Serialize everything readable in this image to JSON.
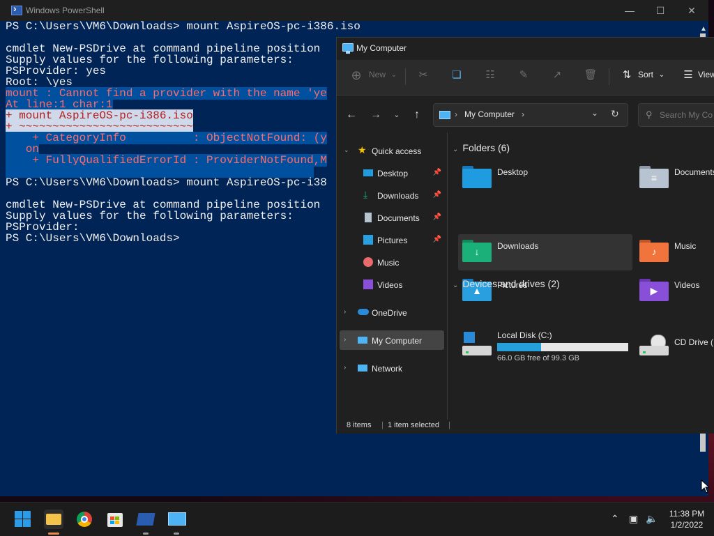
{
  "powershell": {
    "title": "Windows PowerShell",
    "lines": [
      {
        "text": "PS C:\\Users\\VM6\\Downloads> mount AspireOS-pc-i386.iso",
        "style": "normal"
      },
      {
        "text": "",
        "style": "normal"
      },
      {
        "text": "cmdlet New-PSDrive at command pipeline position",
        "style": "normal"
      },
      {
        "text": "Supply values for the following parameters:",
        "style": "normal"
      },
      {
        "text": "PSProvider: yes",
        "style": "normal"
      },
      {
        "text": "Root: \\yes",
        "style": "normal"
      },
      {
        "text": "mount : Cannot find a provider with the name 'ye",
        "style": "err-sel"
      },
      {
        "text": "At line:1 char:1",
        "style": "err-sel"
      },
      {
        "text": "+ mount AspireOS-pc-i386.iso",
        "style": "err-hl"
      },
      {
        "text": "+ ~~~~~~~~~~~~~~~~~~~~~~~~~~",
        "style": "err-hl"
      },
      {
        "text": "    + CategoryInfo          : ObjectNotFound: (y",
        "style": "err-sel"
      },
      {
        "text": "   on",
        "style": "err-sel"
      },
      {
        "text": "    + FullyQualifiedErrorId : ProviderNotFound,M",
        "style": "err-sel"
      },
      {
        "text": "",
        "style": "sel"
      },
      {
        "text": "PS C:\\Users\\VM6\\Downloads> mount AspireOS-pc-i38",
        "style": "normal"
      },
      {
        "text": "",
        "style": "normal"
      },
      {
        "text": "cmdlet New-PSDrive at command pipeline position",
        "style": "normal"
      },
      {
        "text": "Supply values for the following parameters:",
        "style": "normal"
      },
      {
        "text": "PSProvider:",
        "style": "normal"
      },
      {
        "text": "PS C:\\Users\\VM6\\Downloads>",
        "style": "normal"
      }
    ]
  },
  "explorer": {
    "title": "My Computer",
    "toolbar": {
      "new_label": "New",
      "sort_label": "Sort",
      "view_label": "View"
    },
    "address": {
      "crumb": "My Computer",
      "sep": "›"
    },
    "search": {
      "placeholder": "Search My Co"
    },
    "nav": {
      "quick_access": "Quick access",
      "items": [
        {
          "label": "Desktop",
          "icon": "desktop-icon",
          "pinned": true
        },
        {
          "label": "Downloads",
          "icon": "download-icon",
          "pinned": true
        },
        {
          "label": "Documents",
          "icon": "documents-icon",
          "pinned": true
        },
        {
          "label": "Pictures",
          "icon": "pictures-icon",
          "pinned": true
        },
        {
          "label": "Music",
          "icon": "music-icon",
          "pinned": false
        },
        {
          "label": "Videos",
          "icon": "videos-icon",
          "pinned": false
        }
      ],
      "onedrive": "OneDrive",
      "my_computer": "My Computer",
      "network": "Network"
    },
    "folders_header": "Folders (6)",
    "folders": [
      {
        "label": "Desktop",
        "color": "#1f9be0",
        "glyph": ""
      },
      {
        "label": "Documents",
        "color": "#b8c3d1",
        "glyph": "≡"
      },
      {
        "label": "Downloads",
        "color": "#1bb07a",
        "glyph": "↓"
      },
      {
        "label": "Music",
        "color": "#f0743c",
        "glyph": "♪"
      },
      {
        "label": "Pictures",
        "color": "#2a9fe0",
        "glyph": "▲"
      },
      {
        "label": "Videos",
        "color": "#8a4fd8",
        "glyph": "▶"
      }
    ],
    "drives_header": "Devices and drives (2)",
    "drives": [
      {
        "label": "Local Disk (C:)",
        "free_text": "66.0 GB free of 99.3 GB",
        "used_fraction": 0.335
      },
      {
        "label": "CD Drive (D"
      }
    ],
    "status": {
      "items": "8 items",
      "selected": "1 item selected"
    }
  },
  "taskbar": {
    "time": "11:38 PM",
    "date": "1/2/2022"
  }
}
